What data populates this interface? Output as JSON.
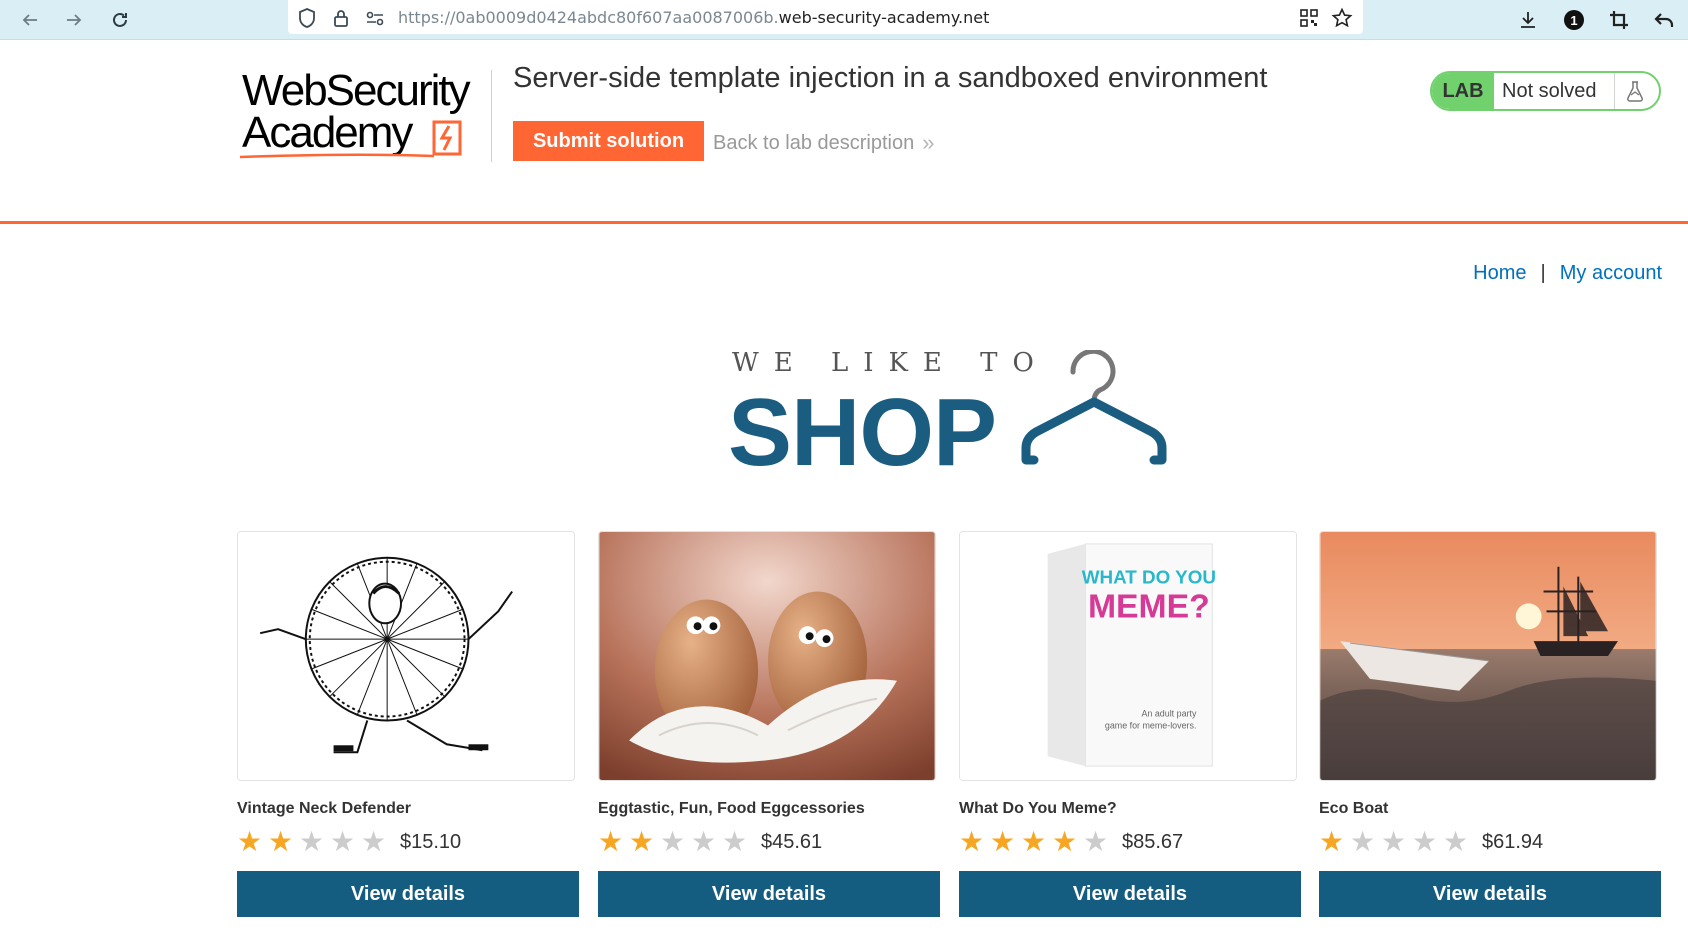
{
  "browser": {
    "url_prefix": "https://0ab0009d0424abdc80f607aa0087006b.",
    "url_host": "web-security-academy.net",
    "icons": [
      "back-arrow-icon",
      "forward-arrow-icon",
      "reload-icon",
      "shield-icon",
      "lock-icon",
      "site-settings-icon",
      "qr-code-icon",
      "bookmark-star-icon",
      "download-icon",
      "extension-badge-icon",
      "crop-icon",
      "undo-icon"
    ],
    "extension_badge": "1"
  },
  "lab_header": {
    "logo_line1": "WebSecurity",
    "logo_line2": "Academy",
    "title": "Server-side template injection in a sandboxed environment",
    "submit_label": "Submit solution",
    "back_label": "Back to lab description",
    "back_chevron": "»",
    "status_badge": "LAB",
    "status_text": "Not solved",
    "accent_color": "#ff6633",
    "status_color": "#70d16d"
  },
  "nav": {
    "home": "Home",
    "separator": "|",
    "my_account": "My account"
  },
  "hero": {
    "small": "WE LIKE TO",
    "big": "SHOP",
    "brand_color": "#1a5d80"
  },
  "products": [
    {
      "name": "Vintage Neck Defender",
      "rating": 2,
      "price": "$15.10",
      "button": "View details",
      "image": "illustration-ruff-collar"
    },
    {
      "name": "Eggtastic, Fun, Food Eggcessories",
      "rating": 2,
      "price": "$45.61",
      "button": "View details",
      "image": "photo-eggs-with-eyes"
    },
    {
      "name": "What Do You Meme?",
      "rating": 4,
      "price": "$85.67",
      "button": "View details",
      "image": "photo-card-game-box"
    },
    {
      "name": "Eco Boat",
      "rating": 1,
      "price": "$61.94",
      "button": "View details",
      "image": "photo-paper-boat-sunset"
    }
  ],
  "box_text": {
    "what": "WHAT DO YOU",
    "meme": "MEME?",
    "tagline1": "An adult party",
    "tagline2": "game for meme-lovers."
  }
}
